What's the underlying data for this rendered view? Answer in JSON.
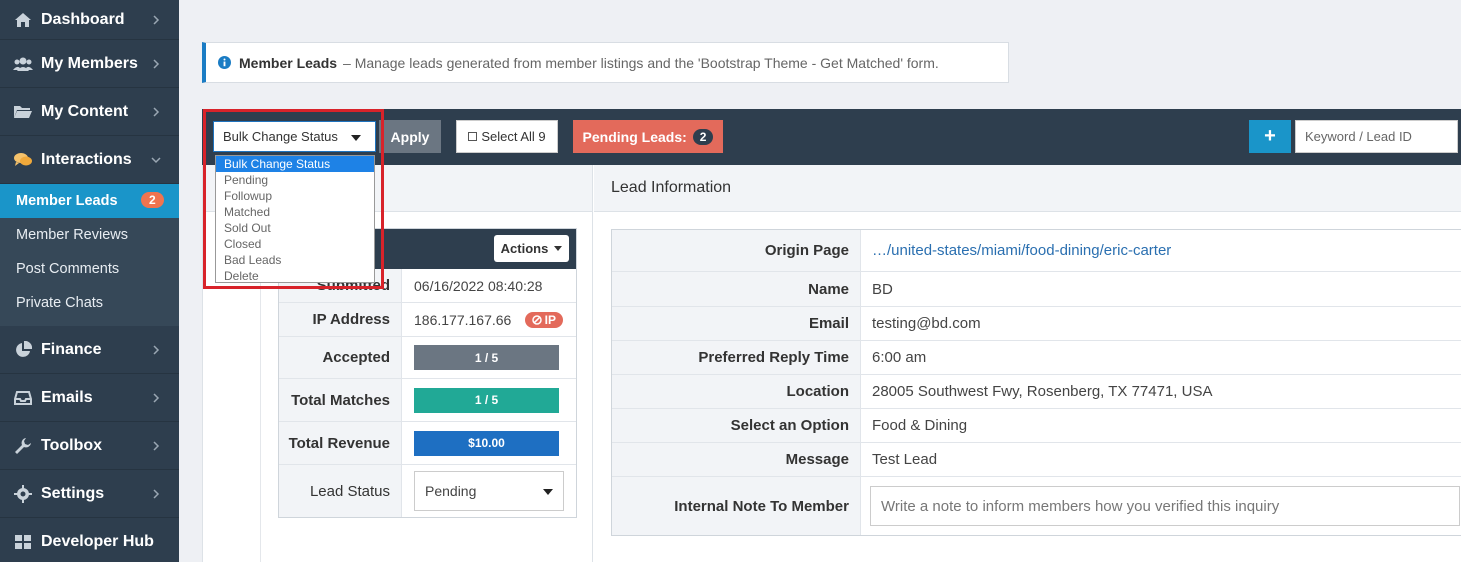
{
  "sidebar": {
    "items_top": [
      {
        "label": "Dashboard",
        "icon": "home-icon"
      },
      {
        "label": "My Members",
        "icon": "users-icon"
      },
      {
        "label": "My Content",
        "icon": "folder-icon"
      },
      {
        "label": "Interactions",
        "icon": "comments-icon"
      }
    ],
    "subitems": [
      {
        "label": "Member Leads",
        "badge": "2"
      },
      {
        "label": "Member Reviews"
      },
      {
        "label": "Post Comments"
      },
      {
        "label": "Private Chats"
      }
    ],
    "items_bottom": [
      {
        "label": "Finance",
        "icon": "pie-chart-icon"
      },
      {
        "label": "Emails",
        "icon": "inbox-icon"
      },
      {
        "label": "Toolbox",
        "icon": "wrench-icon"
      },
      {
        "label": "Settings",
        "icon": "gear-icon"
      },
      {
        "label": "Developer Hub",
        "icon": "grid-icon"
      }
    ]
  },
  "alert": {
    "title": "Member Leads",
    "text": "– Manage leads generated from member listings and the 'Bootstrap Theme - Get Matched' form."
  },
  "toolbar": {
    "bulk_selected": "Bulk Change Status",
    "bulk_options": [
      "Bulk Change Status",
      "Pending",
      "Followup",
      "Matched",
      "Sold Out",
      "Closed",
      "Bad Leads",
      "Delete"
    ],
    "apply_label": "Apply",
    "select_all_label": "Select All 9",
    "pending_label": "Pending Leads:",
    "pending_count": "2",
    "plus_label": "+",
    "search_placeholder": "Keyword / Lead ID"
  },
  "info_card": {
    "actions_label": "Actions",
    "submitted_label": "Submitted",
    "submitted_value": "06/16/2022 08:40:28",
    "ip_label": "IP Address",
    "ip_value": "186.177.167.66",
    "ip_badge": "IP",
    "accepted_label": "Accepted",
    "accepted_value": "1 / 5",
    "total_matches_label": "Total Matches",
    "total_matches_value": "1 / 5",
    "total_revenue_label": "Total Revenue",
    "total_revenue_value": "$10.00",
    "lead_status_label": "Lead Status",
    "lead_status_value": "Pending"
  },
  "lead_info": {
    "heading": "Lead Information",
    "rows": [
      {
        "label": "Origin Page",
        "value": "…/united-states/miami/food-dining/eric-carter"
      },
      {
        "label": "Name",
        "value": "BD"
      },
      {
        "label": "Email",
        "value": "testing@bd.com"
      },
      {
        "label": "Preferred Reply Time",
        "value": "6:00 am"
      },
      {
        "label": "Location",
        "value": "28005 Southwest Fwy, Rosenberg, TX 77471, USA"
      },
      {
        "label": "Select an Option",
        "value": "Food & Dining"
      },
      {
        "label": "Message",
        "value": "Test Lead"
      }
    ],
    "note_label": "Internal Note To Member",
    "note_placeholder": "Write a note to inform members how you verified this inquiry"
  },
  "colors": {
    "sidebar_bg": "#2e3e4e",
    "accent_blue": "#1a95c9",
    "pending_red": "#e36a5b",
    "teal": "#21a996",
    "highlight_red": "#d8232a"
  }
}
